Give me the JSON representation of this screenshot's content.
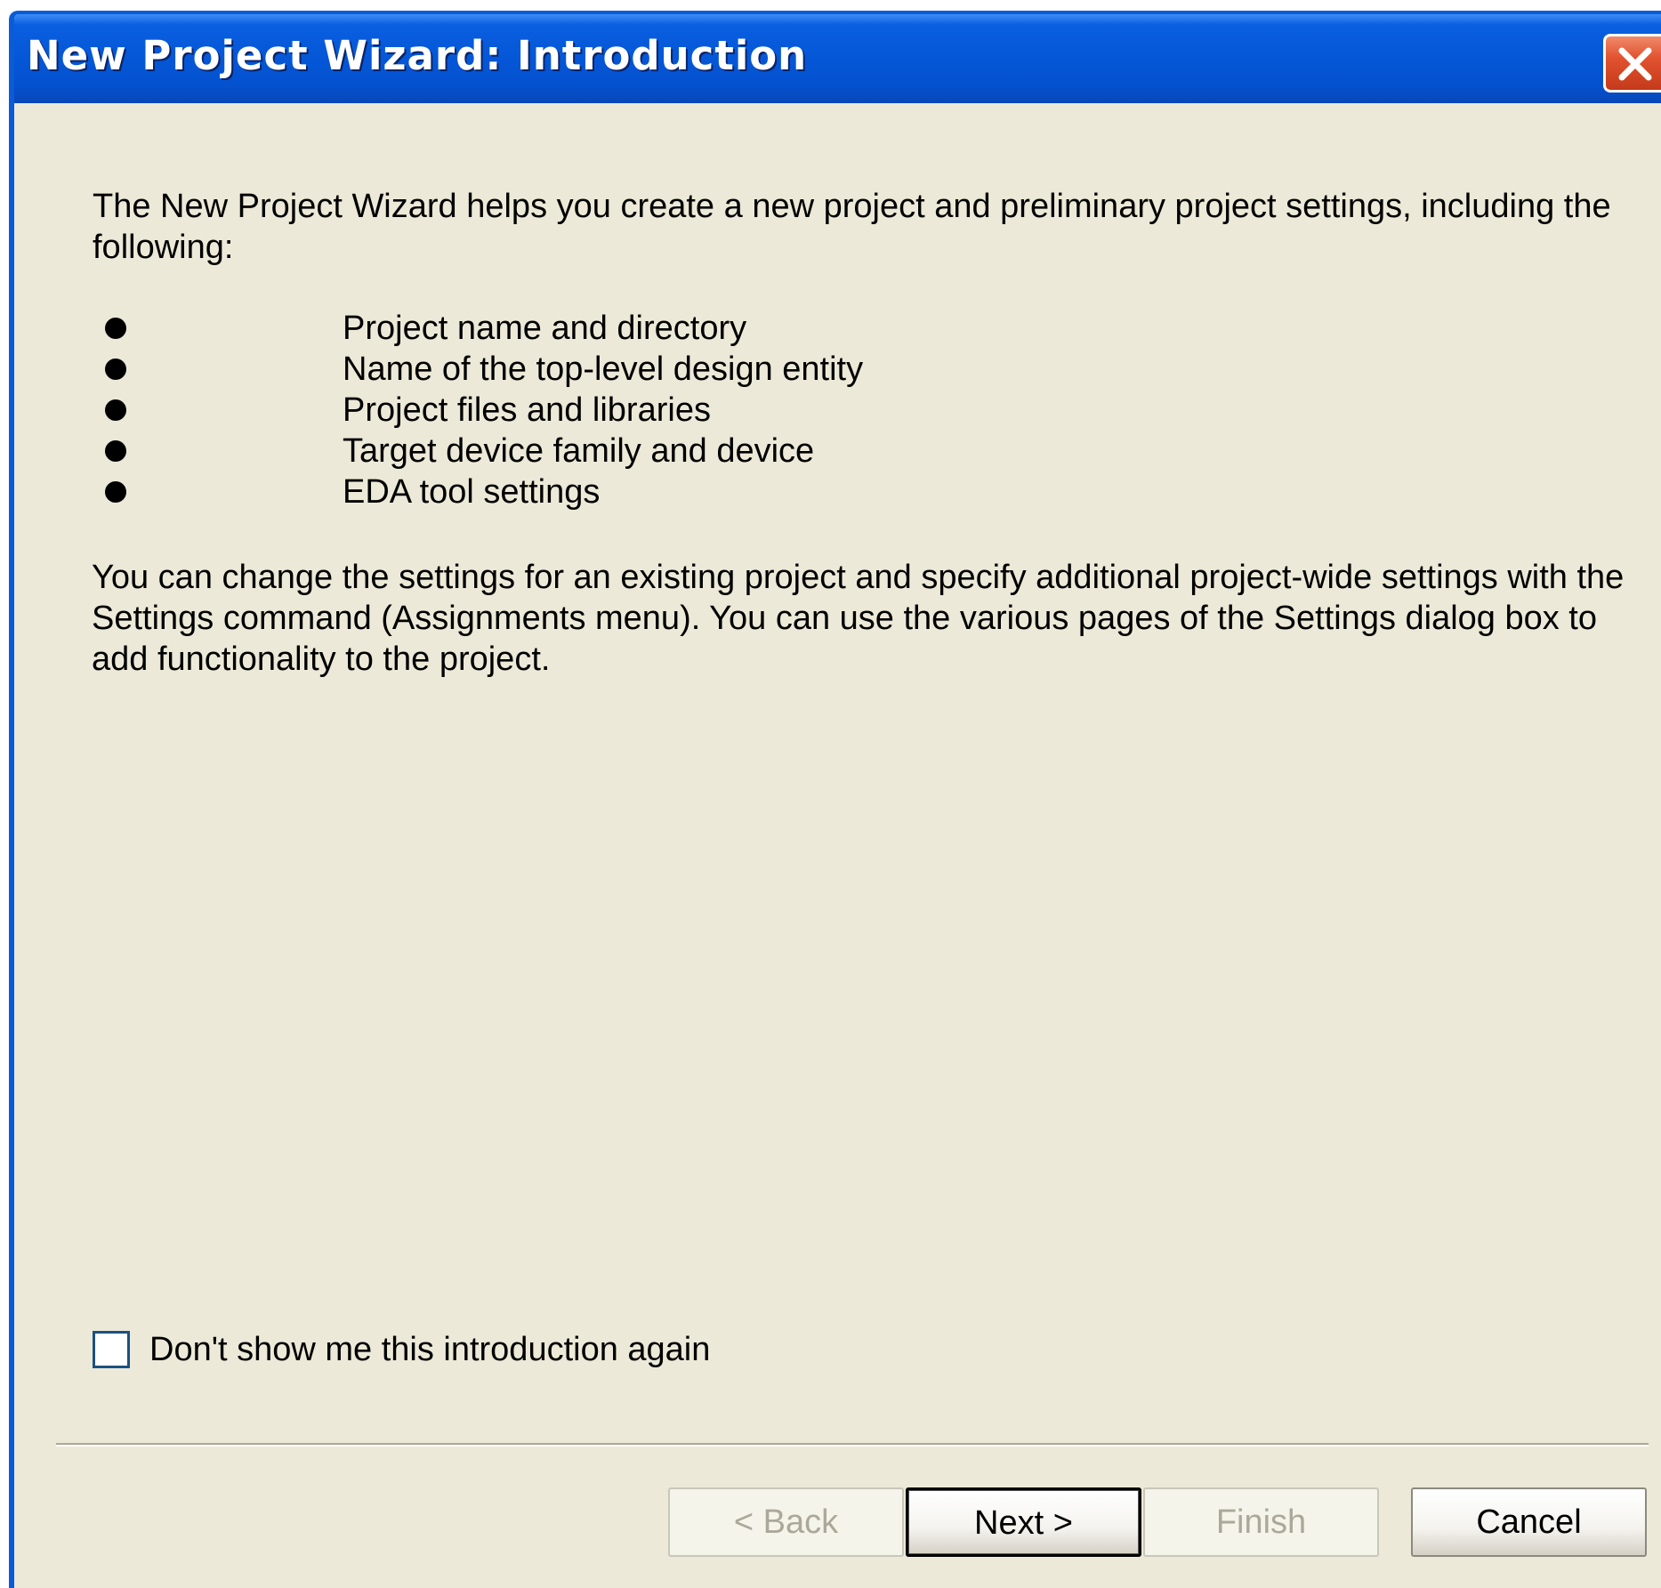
{
  "window": {
    "title": "New Project Wizard: Introduction",
    "close_icon": "close-icon"
  },
  "content": {
    "intro": "The New Project Wizard helps you create a new project and preliminary project settings, including the following:",
    "bullets": [
      "Project name and directory",
      "Name of the top-level design entity",
      "Project files and libraries",
      "Target device family and device",
      "EDA tool settings"
    ],
    "extra": "You can change the settings for an existing project and specify additional project-wide settings with the Settings command (Assignments menu). You can use the various pages of the Settings dialog box to add functionality to the project."
  },
  "checkbox": {
    "label": "Don't show me this introduction again",
    "checked": false
  },
  "buttons": {
    "back": "< Back",
    "next": "Next >",
    "finish": "Finish",
    "cancel": "Cancel"
  },
  "colors": {
    "titlebar": "#0558d8",
    "dialog_background": "#ece9d8",
    "close_button": "#e2522f",
    "disabled_text": "#aca899"
  }
}
